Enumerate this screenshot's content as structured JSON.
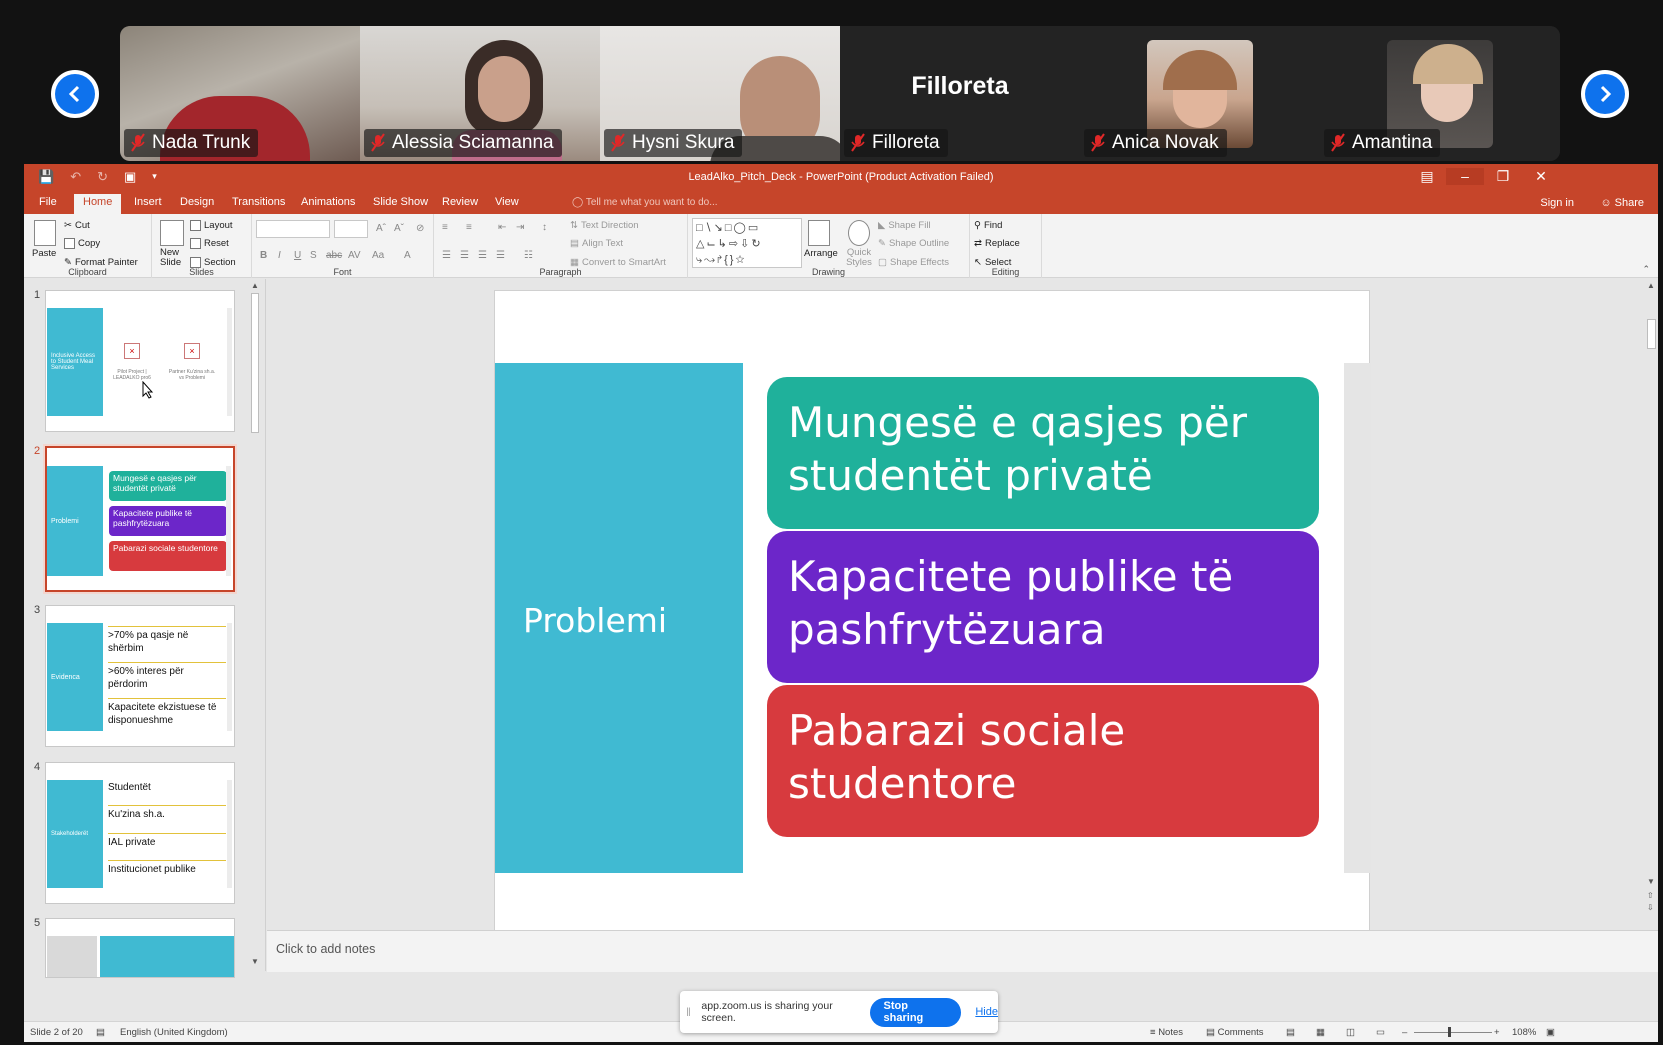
{
  "zoom": {
    "participants": [
      {
        "name": "Nada Trunk",
        "muted": true
      },
      {
        "name": "Alessia Sciamanna",
        "muted": true
      },
      {
        "name": "Hysni Skura",
        "muted": true
      },
      {
        "name": "Filloreta",
        "muted": true,
        "display_text": "Filloreta"
      },
      {
        "name": "Anica Novak",
        "muted": true
      },
      {
        "name": "Amantina",
        "muted": true
      }
    ],
    "share_banner": {
      "message": "app.zoom.us is sharing your screen.",
      "stop_label": "Stop sharing",
      "hide_label": "Hide"
    },
    "colors": {
      "accent": "#0e72ed",
      "mute_red": "#e02828"
    }
  },
  "ppt": {
    "window_title": "LeadAlko_Pitch_Deck - PowerPoint (Product Activation Failed)",
    "tabs": [
      "File",
      "Home",
      "Insert",
      "Design",
      "Transitions",
      "Animations",
      "Slide Show",
      "Review",
      "View"
    ],
    "active_tab": "Home",
    "tell_me": "Tell me what you want to do...",
    "sign_in": "Sign in",
    "share": "Share",
    "ribbon": {
      "clipboard": {
        "label": "Clipboard",
        "paste": "Paste",
        "cut": "Cut",
        "copy": "Copy",
        "format_painter": "Format Painter"
      },
      "slides": {
        "label": "Slides",
        "new_slide": "New Slide",
        "layout": "Layout",
        "reset": "Reset",
        "section": "Section"
      },
      "font": {
        "label": "Font"
      },
      "paragraph": {
        "label": "Paragraph",
        "text_direction": "Text Direction",
        "align_text": "Align Text",
        "convert_smartart": "Convert to SmartArt"
      },
      "drawing": {
        "label": "Drawing",
        "arrange": "Arrange",
        "quick_styles": "Quick Styles",
        "shape_fill": "Shape Fill",
        "shape_outline": "Shape Outline",
        "shape_effects": "Shape Effects"
      },
      "editing": {
        "label": "Editing",
        "find": "Find",
        "replace": "Replace",
        "select": "Select"
      }
    },
    "thumbnails": [
      {
        "num": "1",
        "title": "Inclusive Access to Student Meal Services",
        "captions": [
          "Pilot Project | LEADALKO pro6",
          "Partner Ku'zina sh.a. vs Problemi"
        ]
      },
      {
        "num": "2",
        "title": "Problemi",
        "items": [
          "Mungesë e qasjes për studentët privatë",
          "Kapacitete publike të pashfrytëzuara",
          "Pabarazi sociale studentore"
        ]
      },
      {
        "num": "3",
        "title": "Evidenca",
        "items": [
          ">70% pa qasje në shërbim",
          ">60% interes për përdorim",
          "Kapacitete ekzistuese të disponueshme"
        ]
      },
      {
        "num": "4",
        "title": "Stakeholderët",
        "items": [
          "Studentët",
          "Ku'zina sh.a.",
          "IAL private",
          "Institucionet publike"
        ]
      },
      {
        "num": "5"
      }
    ],
    "slide": {
      "title": "Problemi",
      "boxes": [
        {
          "text": "Mungesë e qasjes për studentët privatë",
          "color": "#1fb19b"
        },
        {
          "text": "Kapacitete publike të pashfrytëzuara",
          "color": "#6c26c9"
        },
        {
          "text": "Pabarazi sociale studentore",
          "color": "#d73a3e"
        }
      ],
      "bar_color": "#40bad2"
    },
    "notes_placeholder": "Click to add notes",
    "status": {
      "slide_of": "Slide 2 of 20",
      "language": "English (United Kingdom)",
      "notes": "Notes",
      "comments": "Comments",
      "zoom": "108%"
    },
    "accent_color": "#c6452a"
  }
}
